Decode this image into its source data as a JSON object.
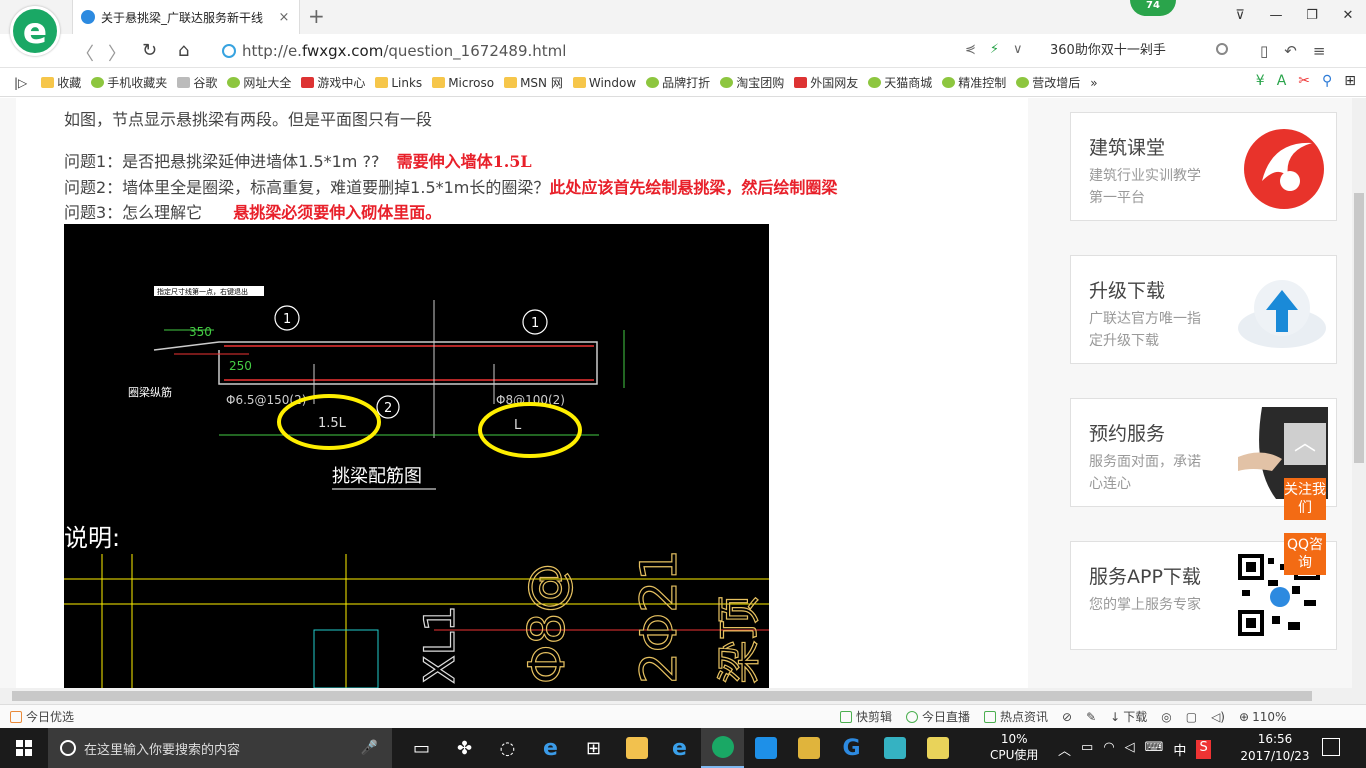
{
  "browser": {
    "logo_letter": "e",
    "tab_title": "关于悬挑梁_广联达服务新干线",
    "tab_close": "×",
    "new_tab": "+",
    "badge": "74",
    "window_controls": [
      "⊽",
      "—",
      "❐",
      "✕"
    ]
  },
  "address": {
    "back": "〈",
    "forward": "〉",
    "reload": "↻",
    "home": "⌂",
    "url_prefix": "http://e.",
    "url_domain": "fwxgx.com",
    "url_path": "/question_1672489.html",
    "share": "⋞",
    "lightning": "⚡",
    "dropdown": "∨",
    "search_text": "360助你双十一剁手",
    "tools": [
      "▯",
      "↶",
      "≡"
    ]
  },
  "bookmarks": {
    "toggle": "|▷",
    "items": [
      {
        "label": "收藏",
        "icon": "star-icon",
        "color": "folder"
      },
      {
        "label": "手机收藏夹",
        "icon": "phone-icon",
        "color": "green"
      },
      {
        "label": "谷歌",
        "icon": "page-icon",
        "color": "gray"
      },
      {
        "label": "网址大全",
        "icon": "globe-icon",
        "color": "green"
      },
      {
        "label": "游戏中心",
        "icon": "game-icon",
        "color": "red"
      },
      {
        "label": "Links",
        "icon": "folder-icon",
        "color": "folder"
      },
      {
        "label": "Microso",
        "icon": "folder-icon",
        "color": "folder"
      },
      {
        "label": "MSN 网",
        "icon": "folder-icon",
        "color": "folder"
      },
      {
        "label": "Window",
        "icon": "folder-icon",
        "color": "folder"
      },
      {
        "label": "品牌打折",
        "icon": "leaf-icon",
        "color": "green"
      },
      {
        "label": "淘宝团购",
        "icon": "leaf-icon",
        "color": "green"
      },
      {
        "label": "外国网友",
        "icon": "flag-icon",
        "color": "red"
      },
      {
        "label": "天猫商城",
        "icon": "leaf-icon",
        "color": "green"
      },
      {
        "label": "精准控制",
        "icon": "chat-icon",
        "color": "green"
      },
      {
        "label": "营改增后",
        "icon": "chat-icon",
        "color": "green"
      }
    ],
    "more": "»",
    "tools": [
      "¥",
      "A",
      "✂",
      "⚲",
      "⊞"
    ]
  },
  "article": {
    "intro": "如图，节点显示悬挑梁有两段。但是平面图只有一段",
    "q1": "问题1：是否把悬挑梁延伸进墙体1.5*1m ??",
    "a1": "需要伸入墙体1.5L",
    "q2": "问题2：墙体里全是圈梁，标高重复，难道要删掉1.5*1m长的圈梁？",
    "a2": "此处应该首先绘制悬挑梁，然后绘制圈梁",
    "q3": "问题3：怎么理解它",
    "a3": "悬挑梁必须要伸入砌体里面。"
  },
  "cad": {
    "hint": "指定尺寸线第一点，右键退出",
    "dim_350": "350",
    "dim_250": "250",
    "marker_1a": "1",
    "marker_1b": "1",
    "marker_2": "2",
    "rebar_left": "Φ6.5@150(2)",
    "rebar_right": "Φ8@100(2)",
    "label_15l": "1.5L",
    "label_l": "L",
    "side_label": "圈梁纵筋",
    "title": "挑梁配筋图",
    "note": "说明:",
    "big_text_1": "XL1",
    "big_text_2": "Φ8@",
    "big_text_3": "2Φ21",
    "big_text_4": "梁顶"
  },
  "sidebar": {
    "cards": [
      {
        "title": "建筑课堂",
        "desc": "建筑行业实训教学第一平台"
      },
      {
        "title": "升级下载",
        "desc": "广联达官方唯一指定升级下载"
      },
      {
        "title": "预约服务",
        "desc": "服务面对面，承诺心连心"
      },
      {
        "title": "服务APP下载",
        "desc": "您的掌上服务专家"
      }
    ],
    "back_top": "︿",
    "follow": "关注我们",
    "qq": "QQ咨询"
  },
  "statusbar": {
    "left": "今日优选",
    "items": [
      "快剪辑",
      "今日直播",
      "热点资讯",
      "下载"
    ],
    "zoom": "110%"
  },
  "taskbar": {
    "search_placeholder": "在这里输入你要搜索的内容",
    "mic": "🎤",
    "cpu_percent": "10%",
    "cpu_label": "CPU使用",
    "ime": "中",
    "time": "16:56",
    "date": "2017/10/23"
  },
  "colors": {
    "red_answer": "#e8202a",
    "cad_background": "#000000",
    "cad_yellow": "#ffef00",
    "follow_orange": "#f36b14",
    "browser_green": "#1aa865"
  }
}
